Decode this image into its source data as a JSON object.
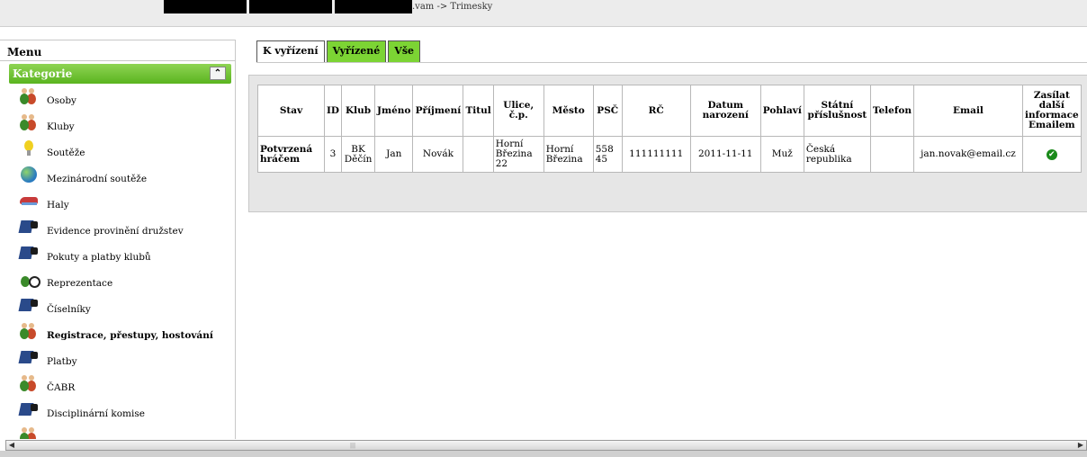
{
  "topbar": {
    "crumb": ".vam -> Trimesky"
  },
  "sidebar": {
    "title": "Menu",
    "category": "Kategorie",
    "toggle": "«",
    "items": [
      {
        "label": "Osoby",
        "icon": "people-icon"
      },
      {
        "label": "Kluby",
        "icon": "people-icon"
      },
      {
        "label": "Soutěže",
        "icon": "bulb-icon"
      },
      {
        "label": "Mezinárodní soutěže",
        "icon": "globe-icon"
      },
      {
        "label": "Haly",
        "icon": "shoe-icon"
      },
      {
        "label": "Evidence provinění družstev",
        "icon": "sport-icon"
      },
      {
        "label": "Pokuty a platby klubů",
        "icon": "sport-icon"
      },
      {
        "label": "Reprezentace",
        "icon": "ball-icon"
      },
      {
        "label": "Číselníky",
        "icon": "sport-icon"
      },
      {
        "label": "Registrace, přestupy, hostování",
        "icon": "people-icon",
        "active": true
      },
      {
        "label": "Platby",
        "icon": "sport-icon"
      },
      {
        "label": "ČABR",
        "icon": "people-icon"
      },
      {
        "label": "Disciplinární komise",
        "icon": "sport-icon"
      }
    ]
  },
  "tabs": [
    {
      "label": "K vyřízení",
      "active": true
    },
    {
      "label": "Vyřízené",
      "active": false
    },
    {
      "label": "Vše",
      "active": false
    }
  ],
  "table": {
    "headers": [
      "Stav",
      "ID",
      "Klub",
      "Jméno",
      "Příjmení",
      "Titul",
      "Ulice, č.p.",
      "Město",
      "PSČ",
      "RČ",
      "Datum narození",
      "Pohlaví",
      "Státní příslušnost",
      "Telefon",
      "Email",
      "Zasílat další informace Emailem"
    ],
    "rows": [
      {
        "stav": "Potvrzená hráčem",
        "id": "3",
        "klub": "BK Děčín",
        "jmeno": "Jan",
        "prijmeni": "Novák",
        "titul": "",
        "ulice": "Horní Březina 22",
        "mesto": "Horní Březina",
        "psc": "558 45",
        "rc": "111111111",
        "datum": "2011-11-11",
        "pohlavi": "Muž",
        "statni": "Česká republika",
        "telefon": "",
        "email": "jan.novak@email.cz",
        "zasilat": "✔"
      }
    ]
  },
  "colors": {
    "green_tab": "#7cd434",
    "category_bar": "#5ab41f",
    "panel": "#e6e6e6"
  }
}
